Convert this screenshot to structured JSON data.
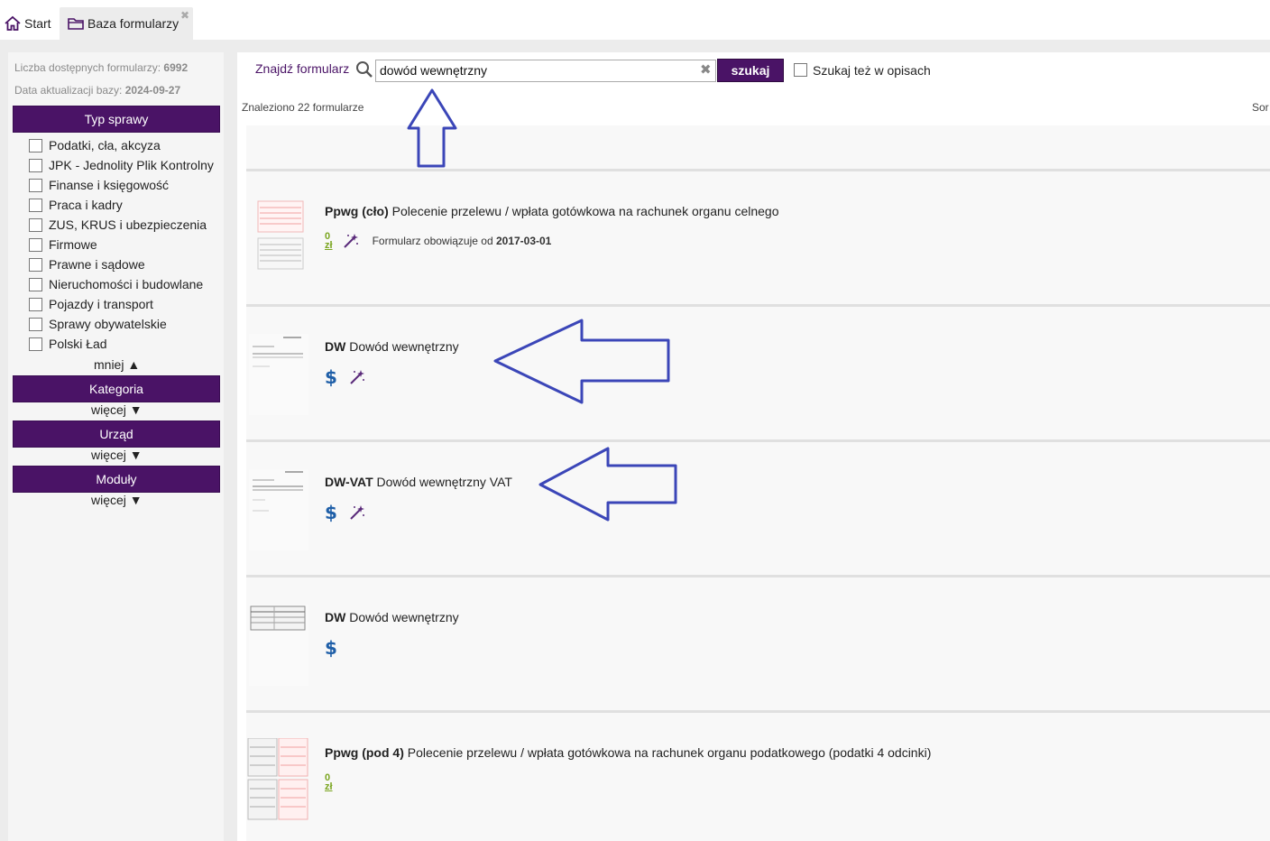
{
  "tabs": {
    "start_label": "Start",
    "baza_label": "Baza formularzy",
    "close_glyph": "✖"
  },
  "sidebar": {
    "count_label": "Liczba dostępnych formularzy:",
    "count_value": "6992",
    "date_label": "Data aktualizacji bazy:",
    "date_value": "2024-09-27",
    "typ_sprawy": {
      "title": "Typ sprawy",
      "items": [
        "Podatki, cła, akcyza",
        "JPK - Jednolity Plik Kontrolny",
        "Finanse i księgowość",
        "Praca i kadry",
        "ZUS, KRUS i ubezpieczenia",
        "Firmowe",
        "Prawne i sądowe",
        "Nieruchomości i budowlane",
        "Pojazdy i transport",
        "Sprawy obywatelskie",
        "Polski Ład"
      ],
      "toggle": "mniej ▲"
    },
    "kategoria": {
      "title": "Kategoria",
      "toggle": "więcej ▼"
    },
    "urzad": {
      "title": "Urząd",
      "toggle": "więcej ▼"
    },
    "moduly": {
      "title": "Moduły",
      "toggle": "więcej ▼"
    }
  },
  "search": {
    "label": "Znajdź formularz",
    "value": "dowód wewnętrzny",
    "button": "szukaj",
    "opis_label": "Szukaj też w opisach",
    "found_text": "Znaleziono 22 formularze",
    "sort_text": "Sor"
  },
  "results": [
    {
      "code": "Ppwg (cło)",
      "title": "Polecenie przelewu / wpłata gotówkowa na rachunek organu celnego",
      "price_icon": "zero-zloty-icon",
      "wizard_icon": true,
      "valid_label": "Formularz obowiązuje od",
      "valid_date": "2017-03-01"
    },
    {
      "code": "DW",
      "title": "Dowód wewnętrzny",
      "price_icon": "dollar-icon",
      "wizard_icon": true
    },
    {
      "code": "DW-VAT",
      "title": "Dowód wewnętrzny VAT",
      "price_icon": "dollar-icon",
      "wizard_icon": true
    },
    {
      "code": "DW",
      "title": "Dowód wewnętrzny",
      "price_icon": "dollar-icon",
      "wizard_icon": false
    },
    {
      "code": "Ppwg (pod 4)",
      "title": "Polecenie przelewu / wpłata gotówkowa na rachunek organu podatkowego (podatki 4 odcinki)",
      "price_icon": "zero-zloty-icon",
      "wizard_icon": false
    }
  ],
  "icons": {
    "dollar": "$",
    "zero_zl_top": "0",
    "zero_zl_bottom": "zł",
    "clear": "✖"
  },
  "colors": {
    "brand_purple": "#4a1366",
    "annotation_arrow": "#3b46b8",
    "dollar_blue": "#1f5fa8",
    "free_green": "#7aa51f"
  }
}
